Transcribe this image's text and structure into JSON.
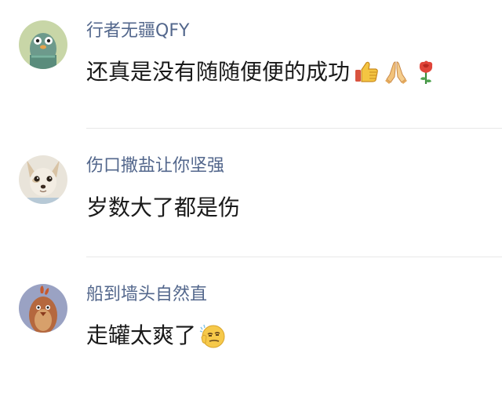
{
  "comments": [
    {
      "username": "行者无疆QFY",
      "text": "还真是没有随随便便的成功",
      "emojis": [
        "thumbs-up-icon",
        "praying-hands-icon",
        "rose-icon"
      ],
      "avatar": "green-bird-avatar"
    },
    {
      "username": "伤口撒盐让你坚强",
      "text": "岁数大了都是伤",
      "emojis": [],
      "avatar": "chihuahua-avatar"
    },
    {
      "username": "船到墙头自然直",
      "text": "走罐太爽了",
      "emojis": [
        "smirk-face-icon"
      ],
      "avatar": "brown-bird-avatar"
    }
  ],
  "colors": {
    "username": "#53678c",
    "text": "#1a1a1a",
    "divider": "#e8e8e8"
  }
}
